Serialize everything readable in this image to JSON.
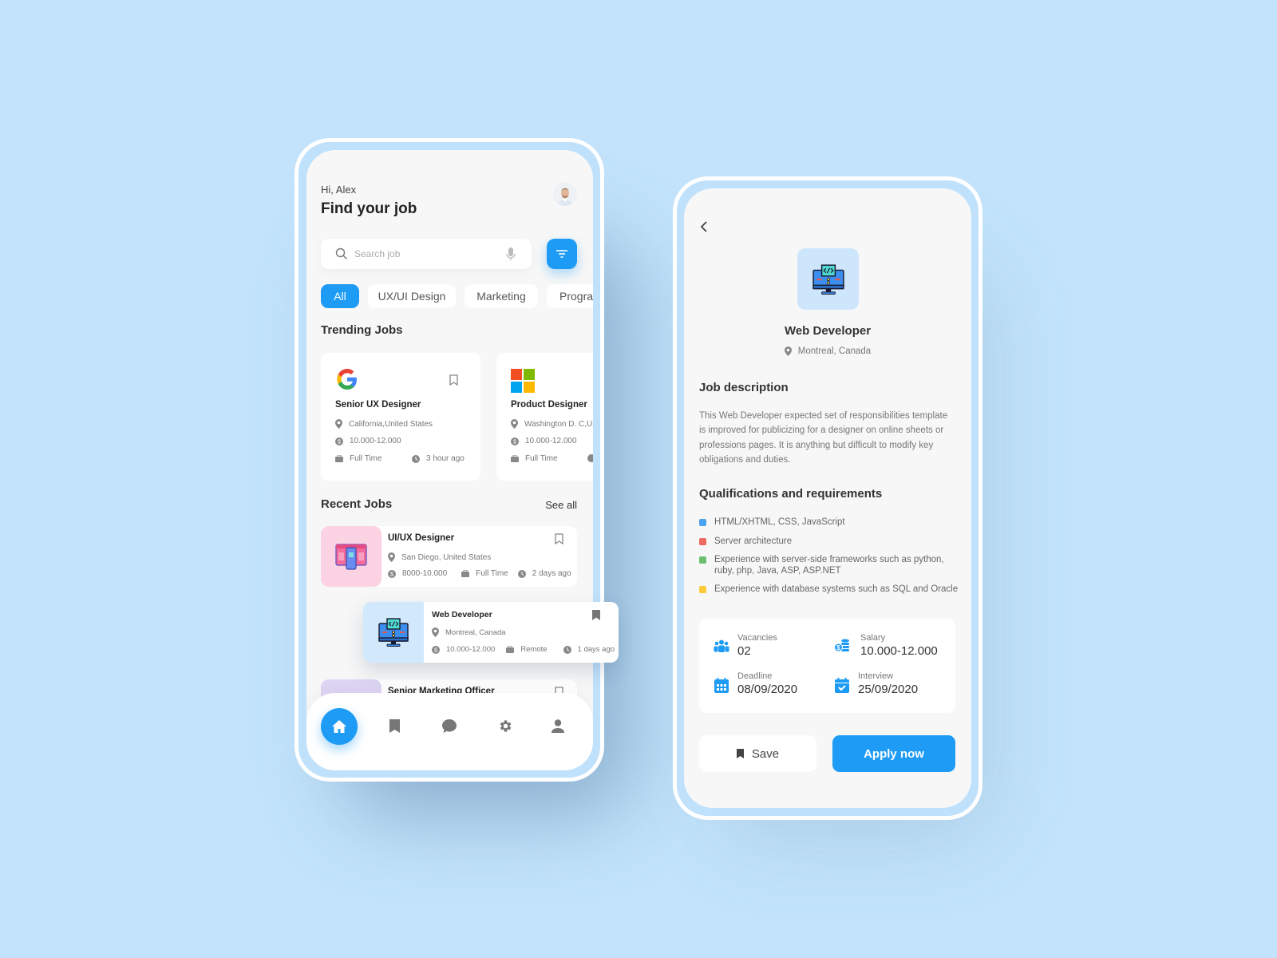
{
  "home": {
    "greeting": "Hi, Alex",
    "title": "Find your job",
    "search_placeholder": "Search job",
    "chips": [
      "All",
      "UX/UI Design",
      "Marketing",
      "Progra"
    ],
    "trending_title": "Trending Jobs",
    "trending": [
      {
        "company_logo": "google-logo",
        "title": "Senior UX Designer",
        "location": "California,United States",
        "salary": "10.000-12.000",
        "type": "Full Time",
        "posted": "3 hour ago"
      },
      {
        "company_logo": "microsoft-logo",
        "title": "Product Designer",
        "location": "Washington D. C,Un",
        "salary": "10.000-12.000",
        "type": "Full Time"
      }
    ],
    "recent_title": "Recent Jobs",
    "see_all": "See all",
    "recent": [
      {
        "title": "UI/UX Designer",
        "location": "San Diego, United States",
        "salary": "8000-10.000",
        "type": "Full Time",
        "posted": "2 days ago",
        "thumb_color": "#fcd3e3"
      },
      {
        "title": "Web Developer",
        "location": "Montreal, Canada",
        "salary": "10.000-12.000",
        "type": "Remote",
        "posted": "1 days ago",
        "thumb_color": "#d2e9fc",
        "saved": true
      },
      {
        "title": "Senior Marketing Officer",
        "thumb_color": "#ddd5f3"
      }
    ],
    "nav": [
      "home-icon",
      "bookmark-icon",
      "chat-icon",
      "settings-icon",
      "profile-icon"
    ]
  },
  "detail": {
    "title": "Web Developer",
    "location": "Montreal, Canada",
    "description_title": "Job description",
    "description_lines": [
      "This Web Developer expected set of responsibilities template",
      "is improved for publicizing for a designer on online sheets or",
      "professions pages. It is anything but difficult to modify key",
      "obligations and duties."
    ],
    "qualifications_title": "Qualifications and requirements",
    "qualifications": [
      {
        "text": "HTML/XHTML, CSS, JavaScript",
        "color": "#4aa3f0"
      },
      {
        "text": "Server architecture",
        "color": "#ef6a62"
      },
      {
        "text": "Experience with server-side frameworks such as python, ruby, php, Java, ASP, ASP.NET",
        "color": "#6cc06f"
      },
      {
        "text": "Experience with database systems such as SQL and Oracle",
        "color": "#fbcb3a"
      }
    ],
    "info": {
      "vacancies_label": "Vacancies",
      "vacancies": "02",
      "salary_label": "Salary",
      "salary": "10.000-12.000",
      "deadline_label": "Deadline",
      "deadline": "08/09/2020",
      "interview_label": "Interview",
      "interview": "25/09/2020"
    },
    "save_label": "Save",
    "apply_label": "Apply now"
  },
  "colors": {
    "accent": "#1e9bf5",
    "background": "#c2e3fb"
  }
}
